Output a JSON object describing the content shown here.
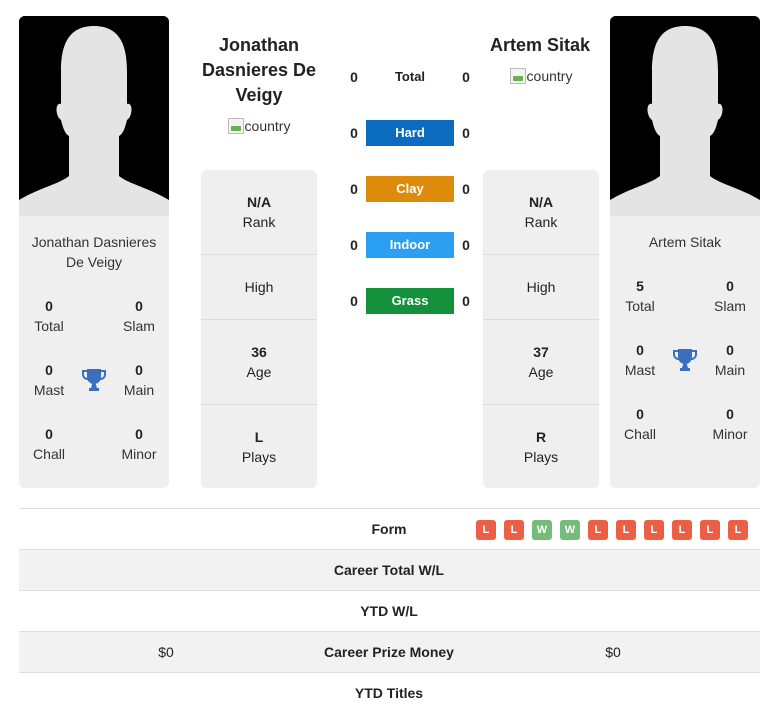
{
  "colors": {
    "hard": "#0b6bbf",
    "clay": "#dd8b0a",
    "indoor": "#2b9ff2",
    "grass": "#14913a",
    "form_loss": "#ec5f45",
    "form_win": "#75bb79",
    "trophy": "#3a6fbf"
  },
  "player1": {
    "header_name": "Jonathan Dasnieres De Veigy",
    "card_name": "Jonathan Dasnieres De Veigy",
    "country_alt": "country",
    "titles": {
      "total": {
        "value": "0",
        "label": "Total"
      },
      "slam": {
        "value": "0",
        "label": "Slam"
      },
      "mast": {
        "value": "0",
        "label": "Mast"
      },
      "main": {
        "value": "0",
        "label": "Main"
      },
      "chall": {
        "value": "0",
        "label": "Chall"
      },
      "minor": {
        "value": "0",
        "label": "Minor"
      }
    },
    "info": {
      "rank": {
        "value": "N/A",
        "label": "Rank"
      },
      "high": {
        "label": "High"
      },
      "age": {
        "value": "36",
        "label": "Age"
      },
      "plays": {
        "value": "L",
        "label": "Plays"
      }
    },
    "prize_money": "$0"
  },
  "player2": {
    "header_name": "Artem Sitak",
    "card_name": "Artem Sitak",
    "country_alt": "country",
    "titles": {
      "total": {
        "value": "5",
        "label": "Total"
      },
      "slam": {
        "value": "0",
        "label": "Slam"
      },
      "mast": {
        "value": "0",
        "label": "Mast"
      },
      "main": {
        "value": "0",
        "label": "Main"
      },
      "chall": {
        "value": "0",
        "label": "Chall"
      },
      "minor": {
        "value": "0",
        "label": "Minor"
      }
    },
    "info": {
      "rank": {
        "value": "N/A",
        "label": "Rank"
      },
      "high": {
        "label": "High"
      },
      "age": {
        "value": "37",
        "label": "Age"
      },
      "plays": {
        "value": "R",
        "label": "Plays"
      }
    },
    "prize_money": "$0"
  },
  "surfaces": [
    {
      "label": "Total",
      "p1": "0",
      "p2": "0"
    },
    {
      "label": "Hard",
      "p1": "0",
      "p2": "0"
    },
    {
      "label": "Clay",
      "p1": "0",
      "p2": "0"
    },
    {
      "label": "Indoor",
      "p1": "0",
      "p2": "0"
    },
    {
      "label": "Grass",
      "p1": "0",
      "p2": "0"
    }
  ],
  "table": {
    "form_label": "Form",
    "form": [
      "L",
      "L",
      "W",
      "W",
      "L",
      "L",
      "L",
      "L",
      "L",
      "L"
    ],
    "career_wl_label": "Career Total W/L",
    "ytd_wl_label": "YTD W/L",
    "prize_label": "Career Prize Money",
    "ytd_titles_label": "YTD Titles"
  }
}
